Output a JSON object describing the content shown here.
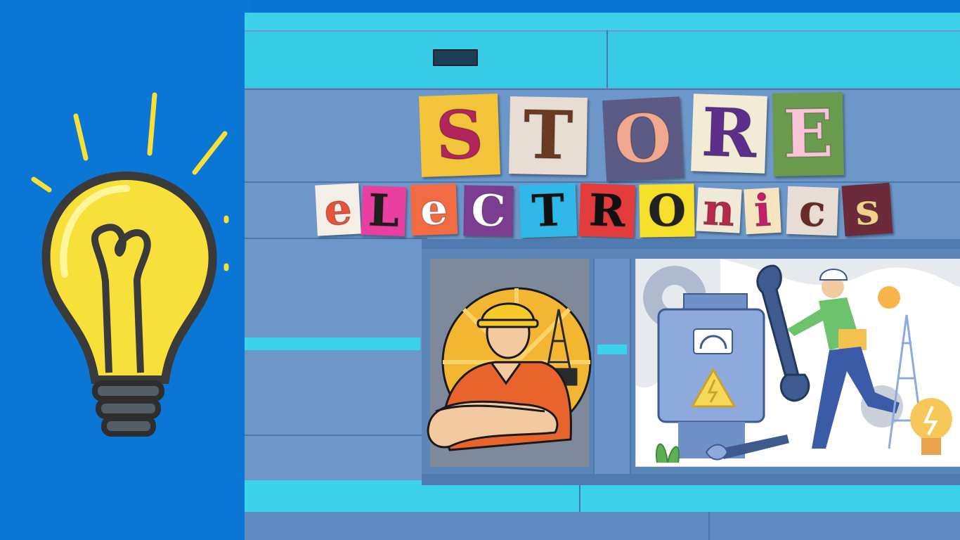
{
  "sign": {
    "line1": [
      "S",
      "T",
      "O",
      "R",
      "E"
    ],
    "line2": [
      "e",
      "L",
      "e",
      "C",
      "T",
      "R",
      "O",
      "n",
      "i",
      "c",
      "s"
    ]
  },
  "colors": {
    "background": "#0b76d4",
    "facade": "#6d97c9",
    "accent_cyan": "#3dd2ec",
    "bulb": "#f7e03a"
  },
  "icons": {
    "bulb": "lightbulb-icon",
    "engineer": "engineer-badge-icon",
    "electrician": "electrician-illustration",
    "wrench": "wrench-icon",
    "pliers": "pliers-icon",
    "meter": "electric-meter-icon"
  }
}
